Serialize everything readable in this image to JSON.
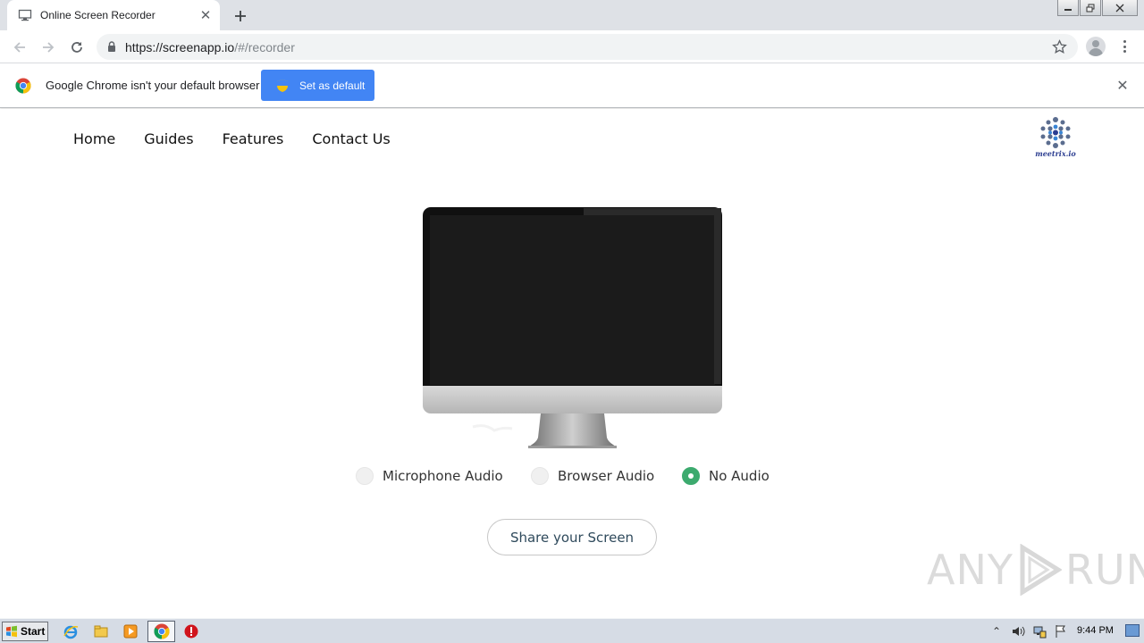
{
  "browser": {
    "tab": {
      "title": "Online Screen Recorder",
      "icon": "monitor-icon",
      "close_icon": "close-icon"
    },
    "new_tab_icon": "plus-icon",
    "window_controls": {
      "minimize": "minimize-icon",
      "restore": "restore-icon",
      "close": "close-icon"
    },
    "toolbar": {
      "back_icon": "arrow-left-icon",
      "forward_icon": "arrow-right-icon",
      "reload_icon": "reload-icon",
      "url_host": "https://screenapp.io",
      "url_path": "/#/recorder",
      "bookmark_icon": "star-icon",
      "profile_icon": "avatar-icon",
      "menu_icon": "kebab-menu-icon"
    },
    "infobar": {
      "message": "Google Chrome isn't your default browser",
      "button_label": "Set as default",
      "close_icon": "close-icon"
    }
  },
  "site": {
    "nav": [
      "Home",
      "Guides",
      "Features",
      "Contact Us"
    ],
    "logo_text": "meetrix.io",
    "audio_options": [
      {
        "label": "Microphone Audio",
        "checked": false
      },
      {
        "label": "Browser Audio",
        "checked": false
      },
      {
        "label": "No Audio",
        "checked": true
      }
    ],
    "share_button": "Share your Screen",
    "accent_color": "#3caa6e"
  },
  "watermark": {
    "left": "ANY",
    "right": "RUN"
  },
  "taskbar": {
    "start_label": "Start",
    "pinned": [
      "ie-icon",
      "explorer-icon",
      "media-player-icon",
      "chrome-icon",
      "stop-icon"
    ],
    "tray": [
      "tray-chevron-icon",
      "volume-icon",
      "network-icon",
      "flag-icon"
    ],
    "clock": "9:44 PM"
  }
}
